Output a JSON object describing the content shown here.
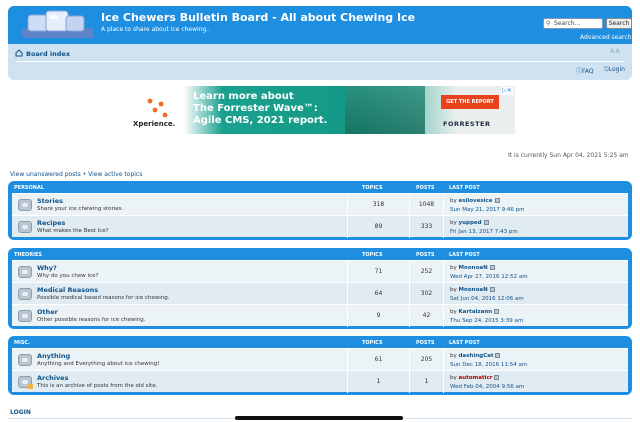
{
  "header": {
    "title": "Ice Chewers Bulletin Board - All about Chewing Ice",
    "description": "A place to share about ice chewing..",
    "search_placeholder": "Search...",
    "search_button": "Search",
    "advanced_search": "Advanced search"
  },
  "nav": {
    "board_index": "Board index",
    "font_control": " A A ",
    "faq": "FAQ",
    "login": "Login"
  },
  "ad": {
    "brand_left": "Xperience.",
    "headline": "Learn more about\nThe Forrester Wave™:\nAgile CMS, 2021 report.",
    "button": "GET THE REPORT",
    "brand_right": "FORRESTER",
    "close": "▷✕"
  },
  "time_line": "It is currently Sun Apr 04, 2021 5:25 am",
  "links": {
    "unanswered": "View unanswered posts",
    "separator": " • ",
    "active": "View active topics"
  },
  "columns": {
    "topics": "TOPICS",
    "posts": "POSTS",
    "last_post": "LAST POST"
  },
  "sections": [
    {
      "title": "PERSONAL",
      "forums": [
        {
          "name": "Stories",
          "desc": "Share your ice chewing stories.",
          "topics": "318",
          "posts": "1048",
          "by": "by",
          "user": "esilovesice",
          "date": "Sun May 21, 2017 9:46 pm",
          "locked": false
        },
        {
          "name": "Recipes",
          "desc": "What makes the Best Ice?",
          "topics": "89",
          "posts": "333",
          "by": "by",
          "user": "yupped",
          "date": "Fri Jan 13, 2017 7:43 pm",
          "locked": false
        }
      ]
    },
    {
      "title": "THEORIES",
      "forums": [
        {
          "name": "Why?",
          "desc": "Why do you chew ice?",
          "topics": "71",
          "posts": "252",
          "by": "by",
          "user": "MnonoaN",
          "date": "Wed Apr 27, 2016 12:52 am",
          "locked": false
        },
        {
          "name": "Medical Reasons",
          "desc": "Possible medical based reasons for ice chewing.",
          "topics": "64",
          "posts": "302",
          "by": "by",
          "user": "MnonoaN",
          "date": "Sat Jun 04, 2016 12:06 am",
          "locked": false
        },
        {
          "name": "Other",
          "desc": "Other possible reasons for ice chewing.",
          "topics": "9",
          "posts": "42",
          "by": "by",
          "user": "Kartalzann",
          "date": "Thu Sep 24, 2015 3:39 am",
          "locked": false
        }
      ]
    },
    {
      "title": "MISC.",
      "forums": [
        {
          "name": "Anything",
          "desc": "Anything and Everything about ice chewing!",
          "topics": "61",
          "posts": "205",
          "by": "by",
          "user": "dashingCat",
          "date": "Sun Dec 18, 2016 11:54 am",
          "locked": false
        },
        {
          "name": "Archives",
          "desc": "This is an archive of posts from the old site.",
          "topics": "1",
          "posts": "1",
          "by": "by",
          "user": "automaticr",
          "date": "Wed Feb 04, 2004 9:56 am",
          "locked": true,
          "user_color": "#aa0000"
        }
      ]
    }
  ],
  "footer": {
    "login": "LOGIN"
  }
}
